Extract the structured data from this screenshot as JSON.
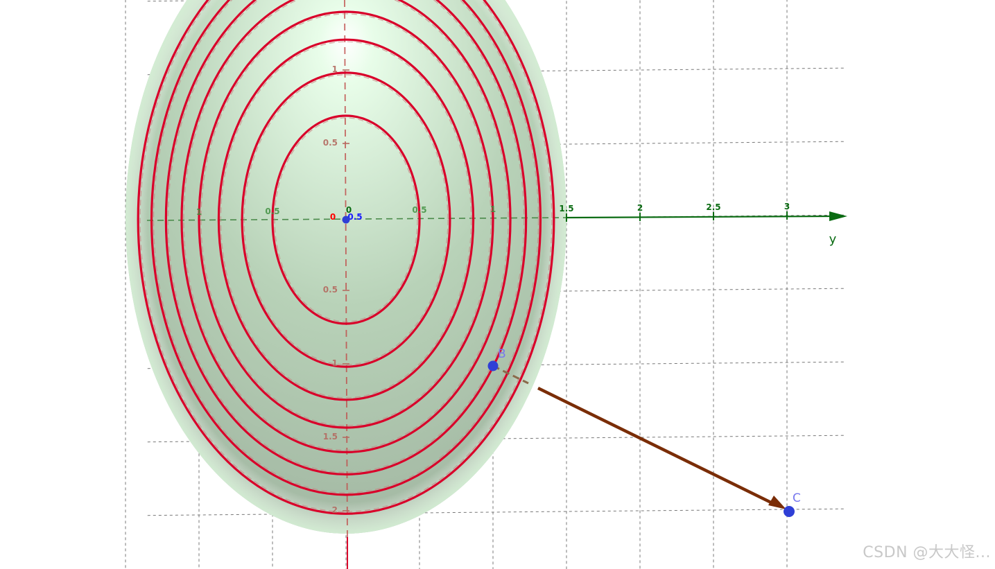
{
  "colors": {
    "surface_light": "#e6fbe6",
    "surface_dark": "#8fae92",
    "contour": "#d9002a",
    "y_axis": "#0a6b12",
    "x_axis_dashed": "#c0504d",
    "z_axis": "#d9002a",
    "grid": "#777777",
    "arrow": "#7a2d07",
    "point": "#2f3fd6",
    "point_label": "#7777ee",
    "origin_label_x": "#ff0000",
    "origin_label_y": "#0a6b12",
    "origin_label_z": "#1a1aff"
  },
  "axes": {
    "y": {
      "name": "y",
      "ticks": [
        {
          "label": "1",
          "v": -1
        },
        {
          "label": "0.5",
          "v": -0.5
        },
        {
          "label": "0",
          "v": 0
        },
        {
          "label": "0.5",
          "v": 0.5
        },
        {
          "label": "1",
          "v": 1
        },
        {
          "label": "1.5",
          "v": 1.5
        },
        {
          "label": "2",
          "v": 2
        },
        {
          "label": "2.5",
          "v": 2.5
        },
        {
          "label": "3",
          "v": 3
        }
      ]
    },
    "x": {
      "ticks": [
        {
          "label": "1",
          "v": -1
        },
        {
          "label": "0.5",
          "v": -0.5
        },
        {
          "label": "0",
          "v": 0
        },
        {
          "label": "0.5",
          "v": 0.5
        },
        {
          "label": "1",
          "v": 1
        },
        {
          "label": "1.5",
          "v": 1.5
        },
        {
          "label": "2",
          "v": 2
        }
      ]
    },
    "z": {
      "label": "0.5"
    }
  },
  "contour_levels": [
    1,
    2,
    3,
    4,
    5,
    6,
    7,
    8
  ],
  "points": {
    "B": {
      "label": "B"
    },
    "C": {
      "label": "C"
    }
  },
  "watermark": "CSDN @大大怪..."
}
